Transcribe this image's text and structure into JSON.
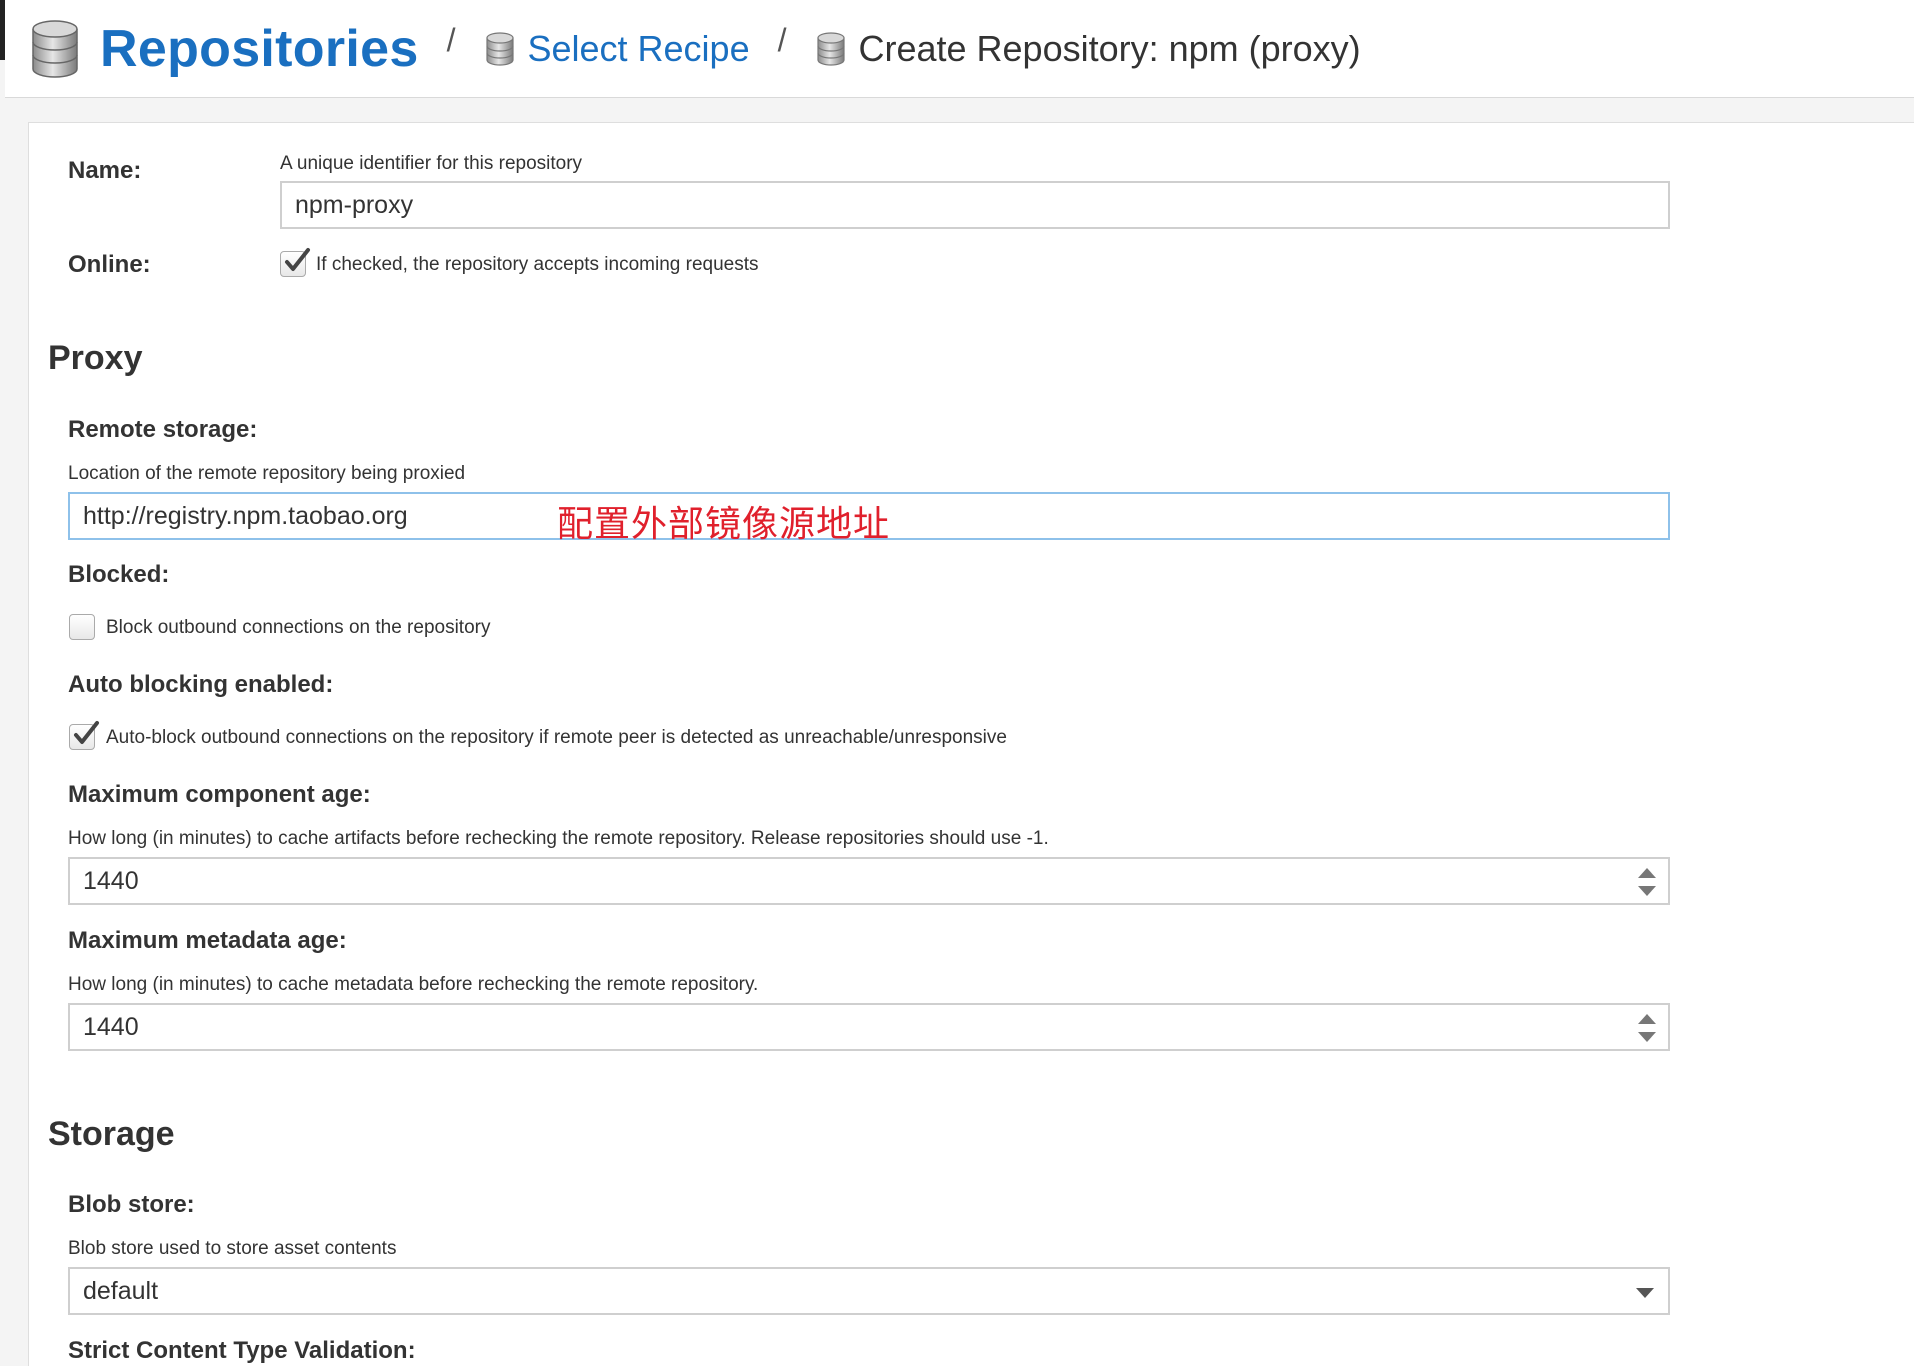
{
  "breadcrumb": {
    "root": "Repositories",
    "separator": "/",
    "step2": "Select Recipe",
    "current": "Create Repository: npm (proxy)"
  },
  "name_field": {
    "label": "Name:",
    "help": "A unique identifier for this repository",
    "value": "npm-proxy"
  },
  "online_field": {
    "label": "Online:",
    "checked": true,
    "text": "If checked, the repository accepts incoming requests"
  },
  "proxy_section": {
    "title": "Proxy",
    "remote_storage": {
      "label": "Remote storage:",
      "help": "Location of the remote repository being proxied",
      "value": "http://registry.npm.taobao.org",
      "annotation": "配置外部镜像源地址"
    },
    "blocked": {
      "label": "Blocked:",
      "checked": false,
      "text": "Block outbound connections on the repository"
    },
    "auto_blocking": {
      "label": "Auto blocking enabled:",
      "checked": true,
      "text": "Auto-block outbound connections on the repository if remote peer is detected as unreachable/unresponsive"
    },
    "max_component_age": {
      "label": "Maximum component age:",
      "help": "How long (in minutes) to cache artifacts before rechecking the remote repository. Release repositories should use -1.",
      "value": "1440"
    },
    "max_metadata_age": {
      "label": "Maximum metadata age:",
      "help": "How long (in minutes) to cache metadata before rechecking the remote repository.",
      "value": "1440"
    }
  },
  "storage_section": {
    "title": "Storage",
    "blob_store": {
      "label": "Blob store:",
      "help": "Blob store used to store asset contents",
      "value": "default"
    },
    "strict_validation": {
      "label": "Strict Content Type Validation:"
    }
  },
  "colors": {
    "link": "#1a6fc0",
    "annotation": "#e0202c",
    "focus_border": "#8ec1ea"
  }
}
